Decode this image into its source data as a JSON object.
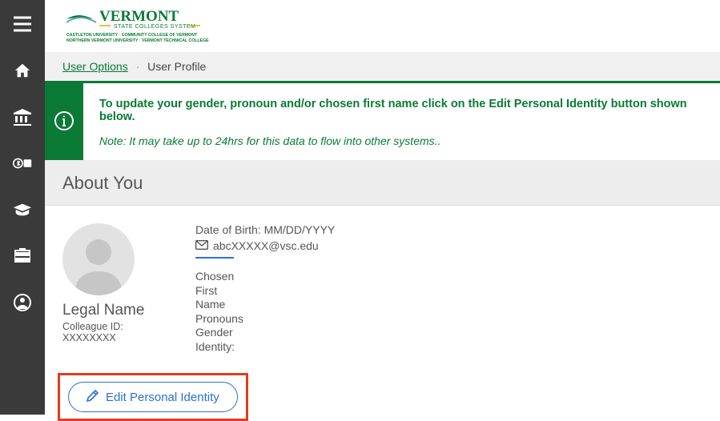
{
  "logo": {
    "brand": "VERMONT",
    "subtitle": "STATE COLLEGES SYSTEM",
    "members": "CASTLETON UNIVERSITY · COMMUNITY COLLEGE OF VERMONT · NORTHERN VERMONT UNIVERSITY · VERMONT TECHNICAL COLLEGE"
  },
  "breadcrumb": {
    "parent": "User Options",
    "current": "User Profile"
  },
  "banner": {
    "title": "To update your gender, pronoun and/or chosen first name click on the Edit Personal Identity button shown below.",
    "note": "Note: It may take up to 24hrs for this data to flow into other systems.."
  },
  "section": {
    "about_you": "About You"
  },
  "profile": {
    "legal_name": "Legal Name",
    "colleague_id_label": "Colleague ID:",
    "colleague_id_value": "XXXXXXXX",
    "dob_label": "Date of Birth:",
    "dob_value": "MM/DD/YYYY",
    "email": "abcXXXXX@vsc.edu",
    "fields": {
      "chosen": "Chosen",
      "first": "First",
      "name": "Name",
      "pronouns": "Pronouns",
      "gender": "Gender",
      "identity": "Identity:"
    }
  },
  "buttons": {
    "edit_identity": "Edit Personal Identity"
  },
  "sidebar": {
    "items": [
      "menu",
      "home",
      "institution",
      "finance",
      "academics",
      "work",
      "user"
    ]
  }
}
